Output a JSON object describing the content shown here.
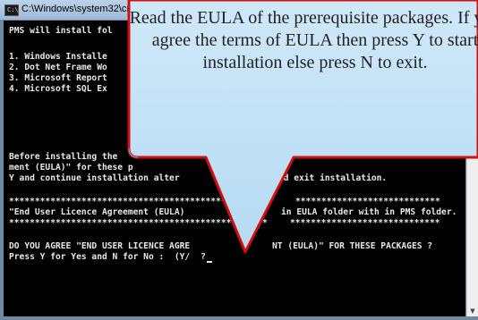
{
  "window": {
    "title": "C:\\Windows\\system32\\cm"
  },
  "console": {
    "lines": [
      "PMS will install fol",
      "1. Windows Installe",
      "2. Dot Net Frame Wo",
      "3. Microsoft Report",
      "4. Microsoft SQL Ex",
      "Before installing the",
      "ment (EULA)\" for these p",
      "Y and continue installation alter",
      "s N and exit installation.",
      "**************************************************",
      "****************************",
      "\"End User Licence Agreement (EULA)",
      "in EULA folder with in PMS folder.",
      "**************************************************",
      "*****************************",
      "DO YOU AGREE \"END USER LICENCE AGRE",
      "NT (EULA)\" FOR THESE PACKAGES ?",
      "Press Y for Yes and N for No :  (Y/",
      "?"
    ]
  },
  "callout": {
    "text": "Read the EULA of the prerequisite packages. If you agree the terms of EULA then press Y to start installation else press N to exit.",
    "fill": "#bfe0f5",
    "border": "#d01010"
  },
  "colors": {
    "console_bg": "#000000",
    "console_fg": "#e8e8e8"
  }
}
